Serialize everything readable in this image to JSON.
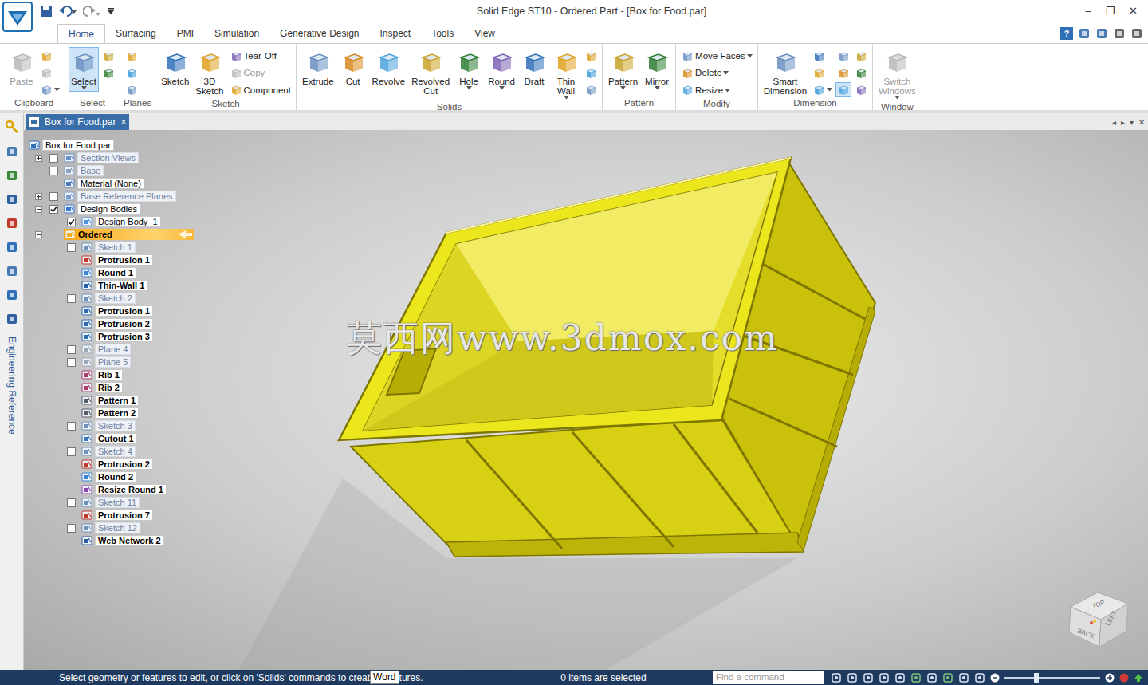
{
  "window": {
    "title": "Solid Edge ST10 - Ordered Part - [Box for Food.par]",
    "controls": [
      "–",
      "❐",
      "✕"
    ]
  },
  "ribbon_tabs": [
    {
      "label": "Home",
      "selected": true
    },
    {
      "label": "Surfacing",
      "selected": false
    },
    {
      "label": "PMI",
      "selected": false
    },
    {
      "label": "Simulation",
      "selected": false
    },
    {
      "label": "Generative Design",
      "selected": false
    },
    {
      "label": "Inspect",
      "selected": false
    },
    {
      "label": "Tools",
      "selected": false
    },
    {
      "label": "View",
      "selected": false
    }
  ],
  "ribbon_help": "?",
  "ribbon_groups": [
    {
      "label": "Clipboard",
      "buttons": [
        {
          "kind": "large",
          "label": "Paste",
          "disabled": true,
          "selected": false,
          "dropdown": false
        },
        {
          "kind": "icon",
          "label": "",
          "disabled": false,
          "selected": false,
          "dropdown": false
        },
        {
          "kind": "icon",
          "label": "",
          "disabled": true,
          "selected": false,
          "dropdown": false
        },
        {
          "kind": "icon",
          "label": "",
          "disabled": false,
          "selected": false,
          "dropdown": true
        }
      ]
    },
    {
      "label": "Select",
      "buttons": [
        {
          "kind": "large",
          "label": "Select",
          "disabled": false,
          "selected": true,
          "dropdown": true
        },
        {
          "kind": "icon",
          "label": "",
          "disabled": false,
          "selected": false,
          "dropdown": false
        },
        {
          "kind": "icon",
          "label": "",
          "disabled": false,
          "selected": false,
          "dropdown": false
        }
      ]
    },
    {
      "label": "Planes",
      "buttons": [
        {
          "kind": "icon",
          "label": "",
          "disabled": false,
          "selected": false,
          "dropdown": false
        },
        {
          "kind": "icon",
          "label": "",
          "disabled": false,
          "selected": false,
          "dropdown": false
        },
        {
          "kind": "icon",
          "label": "",
          "disabled": false,
          "selected": false,
          "dropdown": false
        }
      ]
    },
    {
      "label": "Sketch",
      "buttons": [
        {
          "kind": "large",
          "label": "Sketch",
          "disabled": false,
          "selected": false,
          "dropdown": false
        },
        {
          "kind": "large",
          "label": "3D Sketch",
          "disabled": false,
          "selected": false,
          "dropdown": false
        },
        {
          "kind": "small",
          "label": "Tear-Off",
          "disabled": false,
          "selected": false,
          "dropdown": false
        },
        {
          "kind": "small",
          "label": "Copy",
          "disabled": true,
          "selected": false,
          "dropdown": false
        },
        {
          "kind": "small",
          "label": "Component",
          "disabled": false,
          "selected": false,
          "dropdown": false
        }
      ]
    },
    {
      "label": "Solids",
      "buttons": [
        {
          "kind": "large",
          "label": "Extrude",
          "disabled": false,
          "selected": false,
          "dropdown": false
        },
        {
          "kind": "large",
          "label": "Cut",
          "disabled": false,
          "selected": false,
          "dropdown": false
        },
        {
          "kind": "large",
          "label": "Revolve",
          "disabled": false,
          "selected": false,
          "dropdown": false
        },
        {
          "kind": "large",
          "label": "Revolved Cut",
          "disabled": false,
          "selected": false,
          "dropdown": false
        },
        {
          "kind": "large",
          "label": "Hole",
          "disabled": false,
          "selected": false,
          "dropdown": true
        },
        {
          "kind": "large",
          "label": "Round",
          "disabled": false,
          "selected": false,
          "dropdown": true
        },
        {
          "kind": "large",
          "label": "Draft",
          "disabled": false,
          "selected": false,
          "dropdown": false
        },
        {
          "kind": "large",
          "label": "Thin Wall",
          "disabled": false,
          "selected": false,
          "dropdown": true
        },
        {
          "kind": "icon",
          "label": "",
          "disabled": false,
          "selected": false,
          "dropdown": false
        },
        {
          "kind": "icon",
          "label": "",
          "disabled": false,
          "selected": false,
          "dropdown": false
        },
        {
          "kind": "icon",
          "label": "",
          "disabled": false,
          "selected": false,
          "dropdown": false
        }
      ]
    },
    {
      "label": "Pattern",
      "buttons": [
        {
          "kind": "large",
          "label": "Pattern",
          "disabled": false,
          "selected": false,
          "dropdown": true
        },
        {
          "kind": "large",
          "label": "Mirror",
          "disabled": false,
          "selected": false,
          "dropdown": true
        }
      ]
    },
    {
      "label": "Modify",
      "buttons": [
        {
          "kind": "small",
          "label": "Move Faces",
          "disabled": false,
          "selected": false,
          "dropdown": true
        },
        {
          "kind": "small",
          "label": "Delete",
          "disabled": false,
          "selected": false,
          "dropdown": true
        },
        {
          "kind": "small",
          "label": "Resize",
          "disabled": false,
          "selected": false,
          "dropdown": true
        }
      ]
    },
    {
      "label": "Dimension",
      "buttons": [
        {
          "kind": "large",
          "label": "Smart Dimension",
          "disabled": false,
          "selected": false,
          "dropdown": false
        },
        {
          "kind": "icon",
          "label": "",
          "disabled": false,
          "selected": false,
          "dropdown": false
        },
        {
          "kind": "icon",
          "label": "",
          "disabled": false,
          "selected": false,
          "dropdown": false
        },
        {
          "kind": "icon",
          "label": "",
          "disabled": false,
          "selected": false,
          "dropdown": true
        },
        {
          "kind": "icon",
          "label": "",
          "disabled": false,
          "selected": false,
          "dropdown": false
        },
        {
          "kind": "icon",
          "label": "",
          "disabled": false,
          "selected": false,
          "dropdown": false
        },
        {
          "kind": "icon",
          "label": "",
          "disabled": false,
          "selected": true,
          "dropdown": false
        },
        {
          "kind": "icon",
          "label": "",
          "disabled": false,
          "selected": false,
          "dropdown": false
        },
        {
          "kind": "icon",
          "label": "",
          "disabled": false,
          "selected": false,
          "dropdown": false
        },
        {
          "kind": "icon",
          "label": "",
          "disabled": false,
          "selected": false,
          "dropdown": false
        }
      ]
    },
    {
      "label": "Window",
      "buttons": [
        {
          "kind": "large",
          "label": "Switch Windows",
          "disabled": true,
          "selected": false,
          "dropdown": true
        }
      ]
    }
  ],
  "document_tab": {
    "label": "Box for Food.par",
    "close": "×",
    "controls": [
      "◂",
      "▸",
      "▾",
      "✕"
    ]
  },
  "side_strip": {
    "label": "Engineering Reference"
  },
  "tree": [
    {
      "label": "Box for Food.par",
      "level": 0,
      "kind": "part",
      "expandable": false,
      "expanded": false,
      "checkbox": false,
      "checked": false,
      "dimmed": false,
      "selected": false
    },
    {
      "label": "Section Views",
      "level": 1,
      "kind": "views",
      "expandable": true,
      "expanded": false,
      "checkbox": true,
      "checked": false,
      "dimmed": true,
      "selected": false
    },
    {
      "label": "Base",
      "level": 1,
      "kind": "base",
      "expandable": false,
      "expanded": false,
      "checkbox": true,
      "checked": false,
      "dimmed": true,
      "selected": false
    },
    {
      "label": "Material (None)",
      "level": 1,
      "kind": "material",
      "expandable": false,
      "expanded": false,
      "checkbox": false,
      "checked": false,
      "dimmed": false,
      "selected": false
    },
    {
      "label": "Base Reference Planes",
      "level": 1,
      "kind": "planes",
      "expandable": true,
      "expanded": false,
      "checkbox": true,
      "checked": false,
      "dimmed": true,
      "selected": false
    },
    {
      "label": "Design Bodies",
      "level": 1,
      "kind": "bodies",
      "expandable": true,
      "expanded": true,
      "checkbox": true,
      "checked": true,
      "dimmed": false,
      "selected": false
    },
    {
      "label": "Design Body_1",
      "level": 2,
      "kind": "body",
      "expandable": false,
      "expanded": false,
      "checkbox": true,
      "checked": true,
      "dimmed": false,
      "selected": false
    },
    {
      "label": "Ordered",
      "level": 1,
      "kind": "ordered",
      "expandable": true,
      "expanded": true,
      "checkbox": false,
      "checked": false,
      "dimmed": false,
      "selected": true
    },
    {
      "label": "Sketch 1",
      "level": 2,
      "kind": "sketch",
      "expandable": false,
      "expanded": false,
      "checkbox": true,
      "checked": false,
      "dimmed": true,
      "selected": false
    },
    {
      "label": "Protrusion 1",
      "level": 2,
      "kind": "protrusion",
      "expandable": false,
      "expanded": false,
      "checkbox": false,
      "checked": false,
      "dimmed": false,
      "selected": false
    },
    {
      "label": "Round 1",
      "level": 2,
      "kind": "round",
      "expandable": false,
      "expanded": false,
      "checkbox": false,
      "checked": false,
      "dimmed": false,
      "selected": false
    },
    {
      "label": "Thin-Wall 1",
      "level": 2,
      "kind": "thinwall",
      "expandable": false,
      "expanded": false,
      "checkbox": false,
      "checked": false,
      "dimmed": false,
      "selected": false
    },
    {
      "label": "Sketch 2",
      "level": 2,
      "kind": "sketch",
      "expandable": false,
      "expanded": false,
      "checkbox": true,
      "checked": false,
      "dimmed": true,
      "selected": false
    },
    {
      "label": "Protrusion 1",
      "level": 2,
      "kind": "protrusion2",
      "expandable": false,
      "expanded": false,
      "checkbox": false,
      "checked": false,
      "dimmed": false,
      "selected": false
    },
    {
      "label": "Protrusion 2",
      "level": 2,
      "kind": "protrusion2",
      "expandable": false,
      "expanded": false,
      "checkbox": false,
      "checked": false,
      "dimmed": false,
      "selected": false
    },
    {
      "label": "Protrusion 3",
      "level": 2,
      "kind": "protrusion2",
      "expandable": false,
      "expanded": false,
      "checkbox": false,
      "checked": false,
      "dimmed": false,
      "selected": false
    },
    {
      "label": "Plane 4",
      "level": 2,
      "kind": "plane",
      "expandable": false,
      "expanded": false,
      "checkbox": true,
      "checked": false,
      "dimmed": true,
      "selected": false
    },
    {
      "label": "Plane 5",
      "level": 2,
      "kind": "plane",
      "expandable": false,
      "expanded": false,
      "checkbox": true,
      "checked": false,
      "dimmed": true,
      "selected": false
    },
    {
      "label": "Rib 1",
      "level": 2,
      "kind": "rib",
      "expandable": false,
      "expanded": false,
      "checkbox": false,
      "checked": false,
      "dimmed": false,
      "selected": false
    },
    {
      "label": "Rib 2",
      "level": 2,
      "kind": "rib",
      "expandable": false,
      "expanded": false,
      "checkbox": false,
      "checked": false,
      "dimmed": false,
      "selected": false
    },
    {
      "label": "Pattern 1",
      "level": 2,
      "kind": "pattern",
      "expandable": false,
      "expanded": false,
      "checkbox": false,
      "checked": false,
      "dimmed": false,
      "selected": false
    },
    {
      "label": "Pattern 2",
      "level": 2,
      "kind": "pattern",
      "expandable": false,
      "expanded": false,
      "checkbox": false,
      "checked": false,
      "dimmed": false,
      "selected": false
    },
    {
      "label": "Sketch 3",
      "level": 2,
      "kind": "sketch",
      "expandable": false,
      "expanded": false,
      "checkbox": true,
      "checked": false,
      "dimmed": true,
      "selected": false
    },
    {
      "label": "Cutout 1",
      "level": 2,
      "kind": "cutout",
      "expandable": false,
      "expanded": false,
      "checkbox": false,
      "checked": false,
      "dimmed": false,
      "selected": false
    },
    {
      "label": "Sketch 4",
      "level": 2,
      "kind": "sketch",
      "expandable": false,
      "expanded": false,
      "checkbox": true,
      "checked": false,
      "dimmed": true,
      "selected": false
    },
    {
      "label": "Protrusion 2",
      "level": 2,
      "kind": "protrusion",
      "expandable": false,
      "expanded": false,
      "checkbox": false,
      "checked": false,
      "dimmed": false,
      "selected": false
    },
    {
      "label": "Round 2",
      "level": 2,
      "kind": "round",
      "expandable": false,
      "expanded": false,
      "checkbox": false,
      "checked": false,
      "dimmed": false,
      "selected": false
    },
    {
      "label": "Resize Round 1",
      "level": 2,
      "kind": "resize",
      "expandable": false,
      "expanded": false,
      "checkbox": false,
      "checked": false,
      "dimmed": false,
      "selected": false
    },
    {
      "label": "Sketch 11",
      "level": 2,
      "kind": "sketch",
      "expandable": false,
      "expanded": false,
      "checkbox": true,
      "checked": false,
      "dimmed": true,
      "selected": false
    },
    {
      "label": "Protrusion 7",
      "level": 2,
      "kind": "protrusion",
      "expandable": false,
      "expanded": false,
      "checkbox": false,
      "checked": false,
      "dimmed": false,
      "selected": false
    },
    {
      "label": "Sketch 12",
      "level": 2,
      "kind": "sketch",
      "expandable": false,
      "expanded": false,
      "checkbox": true,
      "checked": false,
      "dimmed": true,
      "selected": false
    },
    {
      "label": "Web Network 2",
      "level": 2,
      "kind": "web",
      "expandable": false,
      "expanded": false,
      "checkbox": false,
      "checked": false,
      "dimmed": false,
      "selected": false
    }
  ],
  "watermark": "莫西网www.3dmox.com",
  "view_cube": {
    "labels": [
      "TOP",
      "LEFT",
      "BACK"
    ]
  },
  "status_bar": {
    "prompt_start": "Select geometry or features to edit, or click on 'Solids' commands to creat",
    "tooltip": "Word",
    "prompt_end": "tures.",
    "selection": "0 items are selected",
    "search_placeholder": "Find a command",
    "zoom": {
      "level": 0.33
    }
  }
}
